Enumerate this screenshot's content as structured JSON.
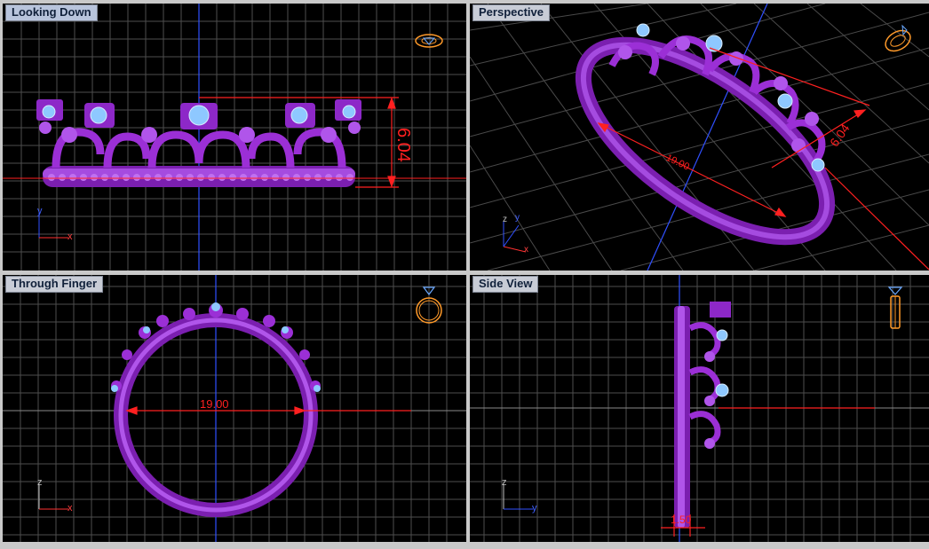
{
  "viewports": {
    "top": {
      "title": "Looking Down",
      "dimension": "6.04",
      "axes": [
        "y",
        "x"
      ]
    },
    "perspective": {
      "title": "Perspective",
      "dimension_height": "6.04",
      "dimension_width": "19.00",
      "axes": [
        "z",
        "y",
        "x"
      ]
    },
    "front": {
      "title": "Through Finger",
      "dimension": "19.00",
      "axes": [
        "z",
        "x"
      ]
    },
    "side": {
      "title": "Side View",
      "dimension": "1.50",
      "axes": [
        "z",
        "y"
      ]
    }
  },
  "colors": {
    "viewport_bg": "#000000",
    "grid": "#5a5a5a",
    "grid_major": "#8a8a8a",
    "ring_purple": "#9b2fd6",
    "gem_blue": "#8ec8ff",
    "dimension_red": "#ff2020",
    "axis_blue": "#3050ff",
    "title_bg": "#c8ccd6"
  },
  "icons": {
    "top": "ring-top-view-icon",
    "perspective": "ring-perspective-icon",
    "front": "ring-front-view-icon",
    "side": "ring-side-view-icon"
  }
}
